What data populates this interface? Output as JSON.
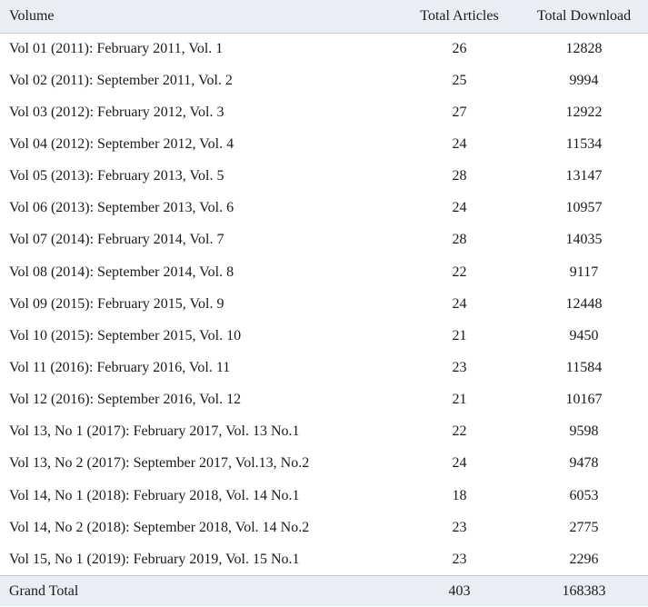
{
  "table": {
    "headers": {
      "volume": "Volume",
      "articles": "Total Articles",
      "downloads": "Total Download"
    },
    "rows": [
      {
        "volume": "Vol 01 (2011): February 2011, Vol. 1",
        "articles": "26",
        "downloads": "12828"
      },
      {
        "volume": "Vol 02 (2011): September 2011, Vol. 2",
        "articles": "25",
        "downloads": "9994"
      },
      {
        "volume": "Vol 03 (2012): February 2012, Vol. 3",
        "articles": "27",
        "downloads": "12922"
      },
      {
        "volume": "Vol 04 (2012): September 2012, Vol. 4",
        "articles": "24",
        "downloads": "11534"
      },
      {
        "volume": "Vol 05 (2013): February 2013, Vol. 5",
        "articles": "28",
        "downloads": "13147"
      },
      {
        "volume": "Vol 06 (2013): September 2013, Vol. 6",
        "articles": "24",
        "downloads": "10957"
      },
      {
        "volume": "Vol 07 (2014): February 2014, Vol. 7",
        "articles": "28",
        "downloads": "14035"
      },
      {
        "volume": "Vol 08 (2014): September 2014, Vol. 8",
        "articles": "22",
        "downloads": "9117"
      },
      {
        "volume": "Vol 09 (2015): February 2015, Vol. 9",
        "articles": "24",
        "downloads": "12448"
      },
      {
        "volume": "Vol 10 (2015): September 2015, Vol. 10",
        "articles": "21",
        "downloads": "9450"
      },
      {
        "volume": "Vol 11 (2016): February 2016, Vol. 11",
        "articles": "23",
        "downloads": "11584"
      },
      {
        "volume": "Vol 12 (2016): September 2016, Vol. 12",
        "articles": "21",
        "downloads": "10167"
      },
      {
        "volume": "Vol 13, No 1 (2017): February 2017, Vol. 13 No.1",
        "articles": "22",
        "downloads": "9598"
      },
      {
        "volume": "Vol 13, No 2 (2017): September 2017, Vol.13, No.2",
        "articles": "24",
        "downloads": "9478"
      },
      {
        "volume": "Vol 14, No 1 (2018): February 2018, Vol. 14 No.1",
        "articles": "18",
        "downloads": "6053"
      },
      {
        "volume": "Vol 14, No 2 (2018): September 2018, Vol. 14 No.2",
        "articles": "23",
        "downloads": "2775"
      },
      {
        "volume": "Vol 15, No 1 (2019): February 2019, Vol. 15 No.1",
        "articles": "23",
        "downloads": "2296"
      }
    ],
    "total": {
      "label": "Grand Total",
      "articles": "403",
      "downloads": "168383"
    }
  },
  "colors": {
    "header_bg": "#e9eef5",
    "footer_bg": "#e9eef5",
    "text": "#1a1a1a"
  }
}
